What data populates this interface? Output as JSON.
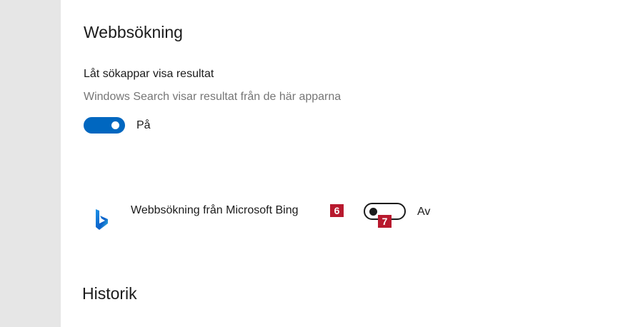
{
  "settings": {
    "web_search": {
      "title": "Webbsökning",
      "let_search_apps": {
        "label": "Låt sökappar visa resultat",
        "description": "Windows Search visar resultat från de här apparna",
        "toggle_state": "on",
        "toggle_label": "På"
      },
      "bing": {
        "icon": "bing-logo-icon",
        "label": "Webbsökning från Microsoft Bing",
        "toggle_state": "off",
        "toggle_label": "Av"
      }
    },
    "history": {
      "title": "Historik"
    }
  },
  "annotations": {
    "badge_6": "6",
    "badge_7": "7"
  },
  "colors": {
    "accent": "#0067c0",
    "left_pane": "#e6e6e6",
    "badge": "#b8192e",
    "secondary_text": "#767676",
    "bing_gradient": [
      "#1d94e8",
      "#0b5fc8",
      "#3bc9e6"
    ]
  }
}
